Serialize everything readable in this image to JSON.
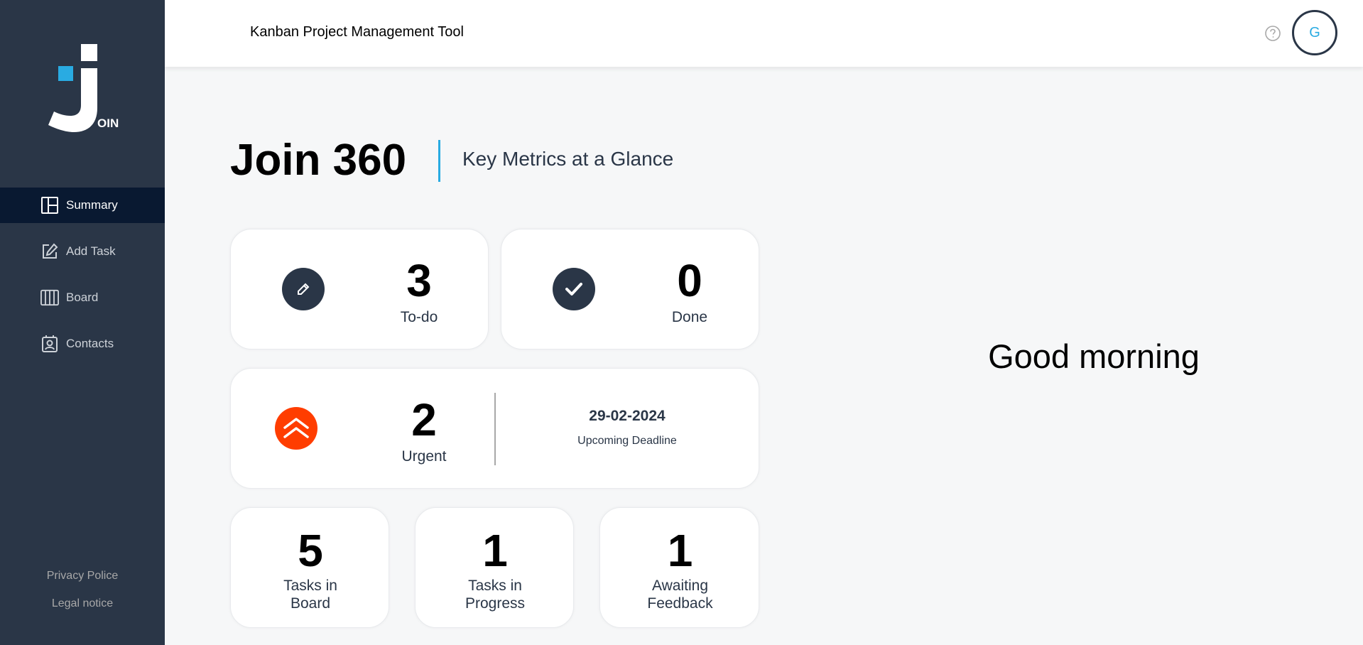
{
  "app": {
    "logo_text": "OIN"
  },
  "sidebar": {
    "items": [
      {
        "label": "Summary",
        "icon": "summary-icon",
        "active": true
      },
      {
        "label": "Add Task",
        "icon": "add-task-icon",
        "active": false
      },
      {
        "label": "Board",
        "icon": "board-icon",
        "active": false
      },
      {
        "label": "Contacts",
        "icon": "contacts-icon",
        "active": false
      }
    ],
    "footer": {
      "privacy": "Privacy Police",
      "legal": "Legal notice"
    }
  },
  "header": {
    "title": "Kanban Project Management Tool",
    "help_icon": "question-circle-icon",
    "avatar_initial": "G"
  },
  "summary": {
    "title": "Join 360",
    "subtitle": "Key Metrics at a Glance",
    "todo": {
      "count": "3",
      "label": "To-do"
    },
    "done": {
      "count": "0",
      "label": "Done"
    },
    "urgent": {
      "count": "2",
      "label": "Urgent"
    },
    "deadline": {
      "date": "29-02-2024",
      "label": "Upcoming Deadline"
    },
    "board": {
      "count": "5",
      "label_line1": "Tasks in",
      "label_line2": "Board"
    },
    "progress": {
      "count": "1",
      "label_line1": "Tasks in",
      "label_line2": "Progress"
    },
    "feedback": {
      "count": "1",
      "label_line1": "Awaiting",
      "label_line2": "Feedback"
    }
  },
  "greeting": "Good morning",
  "colors": {
    "sidebar_bg": "#2a3647",
    "sidebar_active": "#091931",
    "accent_blue": "#29abe2",
    "urgent_orange": "#ff3d00"
  }
}
